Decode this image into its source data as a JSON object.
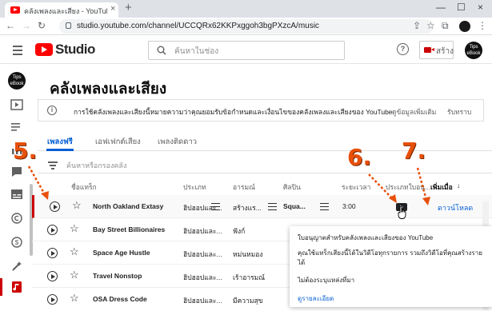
{
  "browser": {
    "tab_title": "คลังเพลงและเสียง - YouTube Studio",
    "tab_close": "×",
    "new_tab": "+",
    "url": "studio.youtube.com/channel/UCCQRx62KKPxggoh3bgPXzcA/music",
    "window_controls": [
      "—",
      "☐",
      "×"
    ]
  },
  "header": {
    "logo_text": "Studio",
    "search_placeholder": "ค้นหาในช่อง",
    "help": "?",
    "create_label": "สร้าง",
    "avatar_text": "Tips eBook"
  },
  "rail": {
    "avatar_text": "Tips eBook",
    "icons": [
      "video-icon",
      "playlist-icon",
      "analytics-icon",
      "comments-icon",
      "subtitles-icon",
      "copyright-icon",
      "monetization-icon",
      "customization-icon",
      "audio-library-icon"
    ]
  },
  "page": {
    "title": "คลังเพลงและเสียง",
    "info_icon": "i",
    "info_text": "การใช้คลังเพลงและเสียงนี้หมายความว่าคุณยอมรับข้อกำหนดและเงื่อนไขของคลังเพลงและเสียงของ YouTube",
    "learn_more": "ดูข้อมูลเพิ่มเติม",
    "got_it": "รับทราบ"
  },
  "tabs": [
    {
      "label": "เพลงฟรี",
      "active": true
    },
    {
      "label": "เอฟเฟกต์เสียง",
      "active": false
    },
    {
      "label": "เพลงติดดาว",
      "active": false
    }
  ],
  "filter": {
    "placeholder": "ค้นหาหรือกรองคลัง"
  },
  "columns": {
    "track": "ชื่อแทร็ก",
    "genre": "ประเภท",
    "mood": "อารมณ์",
    "artist": "ศิลปิน",
    "duration": "ระยะเวลา",
    "license": "ประเภทใบอนุ...",
    "added": "เพิ่มเมื่อ",
    "added_sort": "↓"
  },
  "rows": [
    {
      "track": "North Oakland Extasy",
      "genre": "ฮิปฮอปและ...",
      "mood": "สร้างแร...",
      "artist": "Squa...",
      "duration": "3:00",
      "download": "ดาวน์โหลด"
    },
    {
      "track": "Bay Street Billionaires",
      "genre": "ฮิปฮอปและ...",
      "mood": "ฟังก์"
    },
    {
      "track": "Space Age Hustle",
      "genre": "ฮิปฮอปและ...",
      "mood": "หม่นหมอง"
    },
    {
      "track": "Travel Nonstop",
      "genre": "ฮิปฮอปและ...",
      "mood": "เร้าอารมณ์"
    },
    {
      "track": "OSA Dress Code",
      "genre": "ฮิปฮอปและ...",
      "mood": "มีความสุข"
    }
  ],
  "popup": {
    "line1": "ใบอนุญาตสำหรับคลังเพลงและเสียงของ YouTube",
    "line2a": "คุณใช้แทร็กเสียงนี้ได้ในวิดีโอทุกรายการ รวมถึงวิดีโอที่คุณสร้างราย",
    "line2b": "ได้",
    "line3": "ไม่ต้องระบุแหล่งที่มา",
    "link": "ดูรายละเอียด"
  },
  "annotations": [
    "5.",
    "6.",
    "7."
  ],
  "colors": {
    "accent": "#065fd4",
    "brand": "#ff0000",
    "annotation": "#e8500a"
  }
}
